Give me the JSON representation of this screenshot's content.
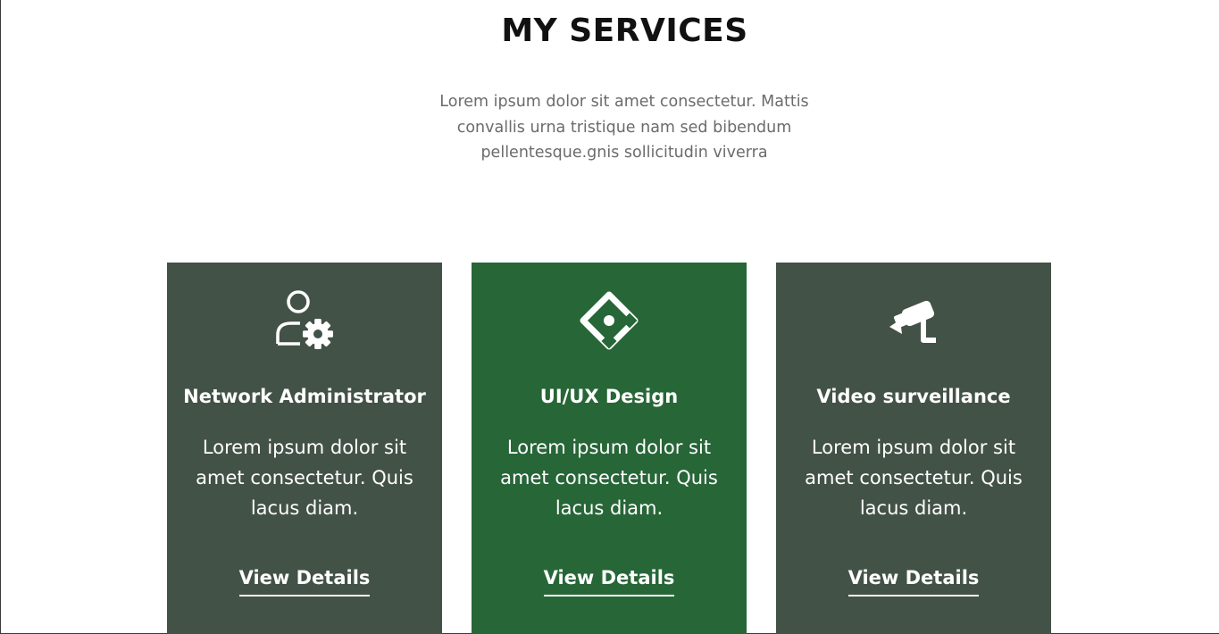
{
  "section": {
    "title": "MY SERVICES",
    "intro": "Lorem ipsum dolor sit amet consectetur. Mattis convallis urna tristique nam sed bibendum pellentesque.gnis sollicitudin viverra"
  },
  "colors": {
    "card_default": "#435246",
    "card_active": "#276637",
    "text_light": "#ffffff",
    "intro_text": "#6b6b6b"
  },
  "cards": [
    {
      "icon": "user-gear-icon",
      "title": "Network Administrator",
      "text": "Lorem ipsum dolor sit amet consectetur. Quis lacus diam.",
      "link": "View Details"
    },
    {
      "icon": "diamond-design-icon",
      "title": "UI/UX Design",
      "text": "Lorem ipsum dolor sit amet consectetur. Quis lacus diam.",
      "link": "View Details",
      "active": true
    },
    {
      "icon": "security-camera-icon",
      "title": "Video surveillance",
      "text": "Lorem ipsum dolor sit amet consectetur. Quis lacus diam.",
      "link": "View Details"
    }
  ]
}
